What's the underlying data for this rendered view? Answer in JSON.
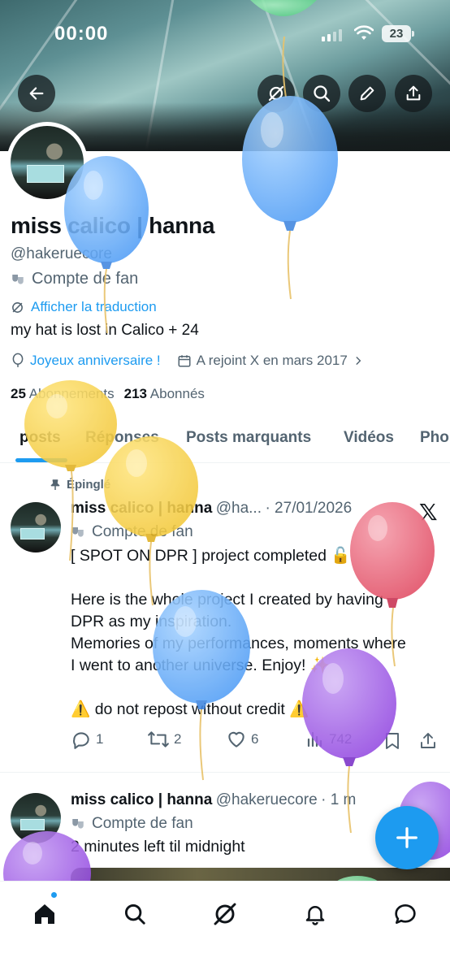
{
  "status_bar": {
    "time": "00:00",
    "battery": "23"
  },
  "profile": {
    "name": "miss calico | hanna",
    "handle": "@hakeruecore",
    "label": "Compte de fan",
    "translate_link": "Afficher la traduction",
    "bio": "my hat is lost in Calico + 24",
    "birthday": "Joyeux anniversaire !",
    "joined": "A rejoint X en mars 2017",
    "following_count": "25",
    "following_label": "Abonnements",
    "followers_count": "213",
    "followers_label": "Abonnés"
  },
  "tabs": [
    "posts",
    "Réponses",
    "Posts marquants",
    "Vidéos",
    "Pho"
  ],
  "pinned_label": "Épinglé",
  "posts": [
    {
      "name": "miss calico | hanna",
      "handle": "@ha...",
      "date": "· 27/01/2026",
      "label": "Compte de fan",
      "lines": [
        "[ SPOT ON DPR ] project completed 🔓",
        "",
        "Here is the whole project I created by having",
        "DPR as my inspiration.",
        "Memories of my performances, moments where",
        "I went to another universe. Enjoy! ✨",
        "",
        "⚠️ do not repost without credit ⚠️"
      ],
      "replies": "1",
      "reposts": "2",
      "likes": "6",
      "views": "742"
    },
    {
      "name": "miss calico | hanna",
      "handle": "@hakeruecore",
      "date": "· 1 m",
      "label": "Compte de fan",
      "text": "2 minutes left til midnight"
    }
  ],
  "icons": [
    "back-icon",
    "incognito-icon",
    "search-icon",
    "edit-icon",
    "share-icon",
    "home-icon",
    "grok-icon",
    "bell-icon",
    "messages-icon"
  ],
  "colors": {
    "accent": "#1d9bf0",
    "text": "#0f1419",
    "muted": "#536471"
  }
}
